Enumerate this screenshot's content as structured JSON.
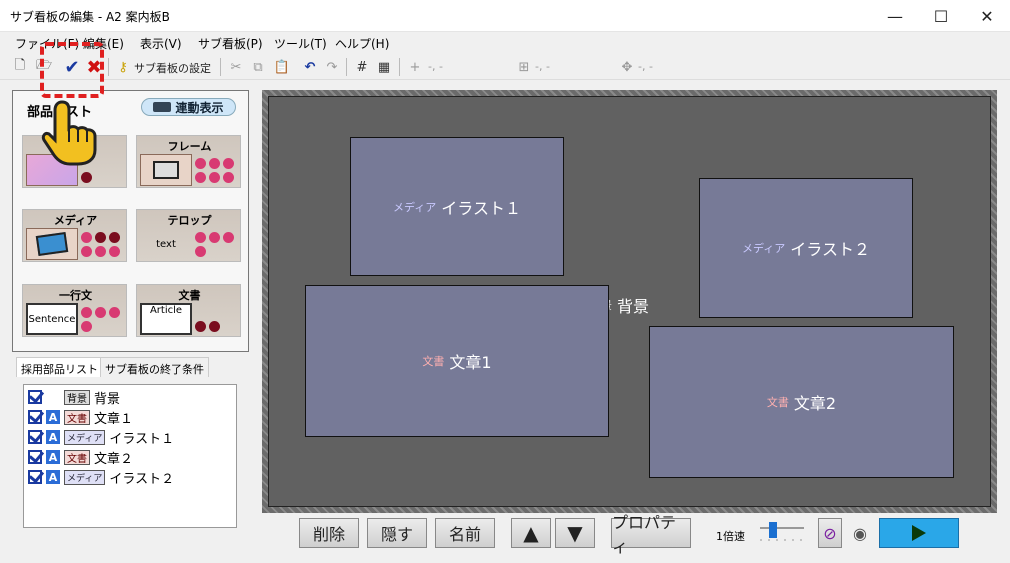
{
  "window": {
    "title": "サブ看板の編集 - A2 案内板B",
    "minimize": "—",
    "maximize": "☐",
    "close": "✕"
  },
  "menu": [
    "ファイル(F)",
    "編集(E)",
    "表示(V)",
    "サブ看板(P)",
    "ツール(T)",
    "ヘルプ(H)"
  ],
  "toolbar": {
    "settings_label": "サブ看板の設定",
    "coord1": "-, -",
    "coord2": "-, -",
    "coord3": "-, -"
  },
  "parts_panel": {
    "title": "部品リスト",
    "link_button": "連動表示",
    "cards": [
      {
        "label": "",
        "thumb": ""
      },
      {
        "label": "フレーム",
        "thumb": ""
      },
      {
        "label": "メディア",
        "thumb": ""
      },
      {
        "label": "テロップ",
        "thumb": "text"
      },
      {
        "label": "一行文",
        "thumb": "Sentence"
      },
      {
        "label": "文書",
        "thumb": "Article"
      }
    ]
  },
  "tabs": [
    "採用部品リスト",
    "サブ看板の終了条件"
  ],
  "parts_list": [
    {
      "badge": "背景",
      "name": "背景",
      "a": false
    },
    {
      "badge": "文書",
      "name": "文章１",
      "a": true
    },
    {
      "badge": "メディア",
      "name": "イラスト１",
      "a": true
    },
    {
      "badge": "文書",
      "name": "文章２",
      "a": true
    },
    {
      "badge": "メディア",
      "name": "イラスト２",
      "a": true
    }
  ],
  "canvas": {
    "background_tag": "背景",
    "background_name": "背景",
    "illust1_tag": "メディア",
    "illust1_name": "イラスト１",
    "illust2_tag": "メディア",
    "illust2_name": "イラスト２",
    "text1_tag": "文書",
    "text1_name": "文章1",
    "text2_tag": "文書",
    "text2_name": "文章2"
  },
  "bottom_bar": {
    "delete": "削除",
    "hide": "隠す",
    "name": "名前",
    "properties": "プロパティ",
    "speed": "1倍速"
  },
  "colors": {
    "canvas": "#616161",
    "box": "#777a97",
    "play": "#2aa7e8",
    "highlight": "#e02020"
  }
}
